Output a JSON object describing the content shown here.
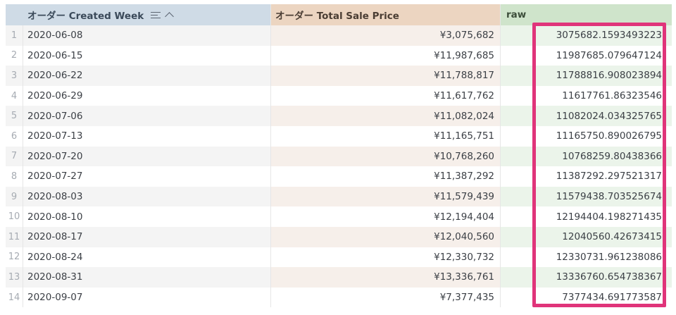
{
  "header": {
    "week_label": "オーダー Created Week",
    "price_label": "オーダー Total Sale Price",
    "raw_label": "raw"
  },
  "rows": [
    {
      "idx": "1",
      "week": "2020-06-08",
      "price": "¥3,075,682",
      "raw": "3075682.1593493223"
    },
    {
      "idx": "2",
      "week": "2020-06-15",
      "price": "¥11,987,685",
      "raw": "11987685.079647124"
    },
    {
      "idx": "3",
      "week": "2020-06-22",
      "price": "¥11,788,817",
      "raw": "11788816.908023894"
    },
    {
      "idx": "4",
      "week": "2020-06-29",
      "price": "¥11,617,762",
      "raw": "11617761.86323546"
    },
    {
      "idx": "5",
      "week": "2020-07-06",
      "price": "¥11,082,024",
      "raw": "11082024.034325765"
    },
    {
      "idx": "6",
      "week": "2020-07-13",
      "price": "¥11,165,751",
      "raw": "11165750.890026795"
    },
    {
      "idx": "7",
      "week": "2020-07-20",
      "price": "¥10,768,260",
      "raw": "10768259.80438366"
    },
    {
      "idx": "8",
      "week": "2020-07-27",
      "price": "¥11,387,292",
      "raw": "11387292.297521317"
    },
    {
      "idx": "9",
      "week": "2020-08-03",
      "price": "¥11,579,439",
      "raw": "11579438.703525674"
    },
    {
      "idx": "10",
      "week": "2020-08-10",
      "price": "¥12,194,404",
      "raw": "12194404.198271435"
    },
    {
      "idx": "11",
      "week": "2020-08-17",
      "price": "¥12,040,560",
      "raw": "12040560.42673415"
    },
    {
      "idx": "12",
      "week": "2020-08-24",
      "price": "¥12,330,732",
      "raw": "12330731.961238086"
    },
    {
      "idx": "13",
      "week": "2020-08-31",
      "price": "¥13,336,761",
      "raw": "13336760.654738367"
    },
    {
      "idx": "14",
      "week": "2020-09-07",
      "price": "¥7,377,435",
      "raw": "7377434.691773587"
    }
  ],
  "icons": {
    "sort_menu": "sort-menu-icon",
    "sort_direction": "chevron-up-icon"
  },
  "colors": {
    "highlight": "#e0347a",
    "week_header": "#cfdbe6",
    "price_header": "#ecd5c1",
    "raw_header": "#cfe4cb"
  }
}
